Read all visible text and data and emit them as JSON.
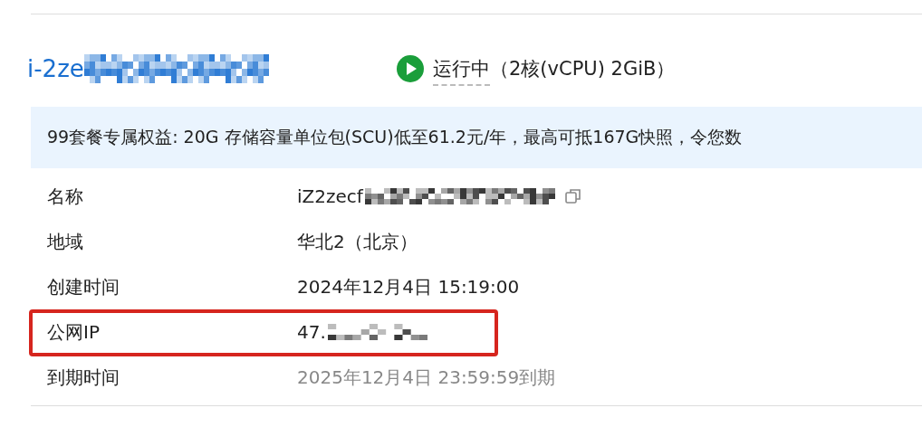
{
  "instance": {
    "id_visible": "i-2ze",
    "status": "运行中",
    "spec": "（2核(vCPU) 2GiB）"
  },
  "banner": "99套餐专属权益: 20G 存储容量单位包(SCU)低至61.2元/年，最高可抵167G快照，令您数",
  "fields": [
    {
      "label": "名称",
      "value": "iZ2zecf",
      "redacted": true,
      "copyable": true
    },
    {
      "label": "地域",
      "value": "华北2（北京）"
    },
    {
      "label": "创建时间",
      "value": "2024年12月4日 15:19:00"
    },
    {
      "label": "公网IP",
      "value": "47.",
      "redacted": true,
      "highlighted": true
    },
    {
      "label": "到期时间",
      "value": "2025年12月4日 23:59:59到期",
      "muted": true
    }
  ]
}
